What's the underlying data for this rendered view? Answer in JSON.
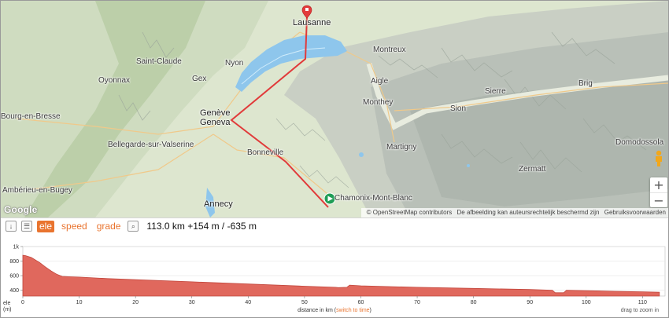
{
  "map": {
    "places": [
      {
        "name": "Lausanne",
        "big": true
      },
      {
        "name": "Montreux",
        "big": false
      },
      {
        "name": "Nyon",
        "big": false
      },
      {
        "name": "Saint-Claude",
        "big": false
      },
      {
        "name": "Gex",
        "big": false
      },
      {
        "name": "Oyonnax",
        "big": false
      },
      {
        "name": "Aigle",
        "big": false
      },
      {
        "name": "Monthey",
        "big": false
      },
      {
        "name": "Sion",
        "big": false
      },
      {
        "name": "Sierre",
        "big": false
      },
      {
        "name": "Brig",
        "big": false
      },
      {
        "name": "Bourg-en-Bresse",
        "big": false
      },
      {
        "name": "Genève",
        "big": true
      },
      {
        "name": "Geneva",
        "big": true
      },
      {
        "name": "Bellegarde-sur-Valserine",
        "big": false
      },
      {
        "name": "Bonneville",
        "big": false
      },
      {
        "name": "Martigny",
        "big": false
      },
      {
        "name": "Domodossola",
        "big": false
      },
      {
        "name": "Zermatt",
        "big": false
      },
      {
        "name": "Ambérieu-en-Bugey",
        "big": false
      },
      {
        "name": "Annecy",
        "big": true
      },
      {
        "name": "Chamonix-Mont-Blanc",
        "big": false
      }
    ],
    "google_logo": "Google",
    "attribution": {
      "osm": "© OpenStreetMap contributors",
      "copyright": "De afbeelding kan auteursrechtelijk beschermd zijn",
      "terms": "Gebruiksvoorwaarden"
    },
    "zoom": {
      "in": "+",
      "out": "−"
    },
    "colors": {
      "route": "#e13a3a",
      "start_marker": "#1f9d55",
      "end_marker": "#e23b3b",
      "lake": "#8ec6ec"
    }
  },
  "toolbar": {
    "collapse_icon": "↓",
    "menu_icon": "☰",
    "tabs": [
      {
        "label": "ele",
        "active": true
      },
      {
        "label": "speed",
        "active": false
      },
      {
        "label": "grade",
        "active": false
      }
    ],
    "zoom_icon": "⌕",
    "stats": "113.0 km +154 m / -635 m"
  },
  "profile": {
    "y_unit_label": "ele",
    "y_unit": "(m)",
    "x_label": "distance in km (",
    "x_label_link": "switch to time",
    "x_label_end": ")",
    "drag_hint": "drag to zoom in",
    "fill_color": "#e0685d",
    "stroke_color": "#c2473d"
  },
  "chart_data": {
    "type": "area",
    "title": "",
    "xlabel": "distance in km",
    "ylabel": "ele (m)",
    "xlim": [
      0,
      114
    ],
    "ylim": [
      320,
      1000
    ],
    "x_ticks": [
      0,
      10,
      20,
      30,
      40,
      50,
      60,
      70,
      80,
      90,
      100,
      110
    ],
    "y_ticks": [
      {
        "value": 400,
        "label": "400"
      },
      {
        "value": 600,
        "label": "600"
      },
      {
        "value": 800,
        "label": "800"
      },
      {
        "value": 1000,
        "label": "1k"
      }
    ],
    "series": [
      {
        "x": [
          0,
          0.5,
          1.5,
          3,
          4,
          5,
          6,
          7,
          8,
          10,
          15,
          20,
          30,
          40,
          50,
          55.5,
          56,
          57.5,
          58,
          60,
          70,
          80,
          90,
          94,
          94.5,
          96,
          96.5,
          100,
          105,
          110,
          113
        ],
        "y": [
          880,
          875,
          850,
          780,
          720,
          665,
          620,
          590,
          585,
          580,
          560,
          545,
          515,
          485,
          455,
          440,
          435,
          440,
          470,
          460,
          440,
          425,
          410,
          400,
          365,
          365,
          400,
          395,
          385,
          378,
          372
        ]
      }
    ]
  }
}
